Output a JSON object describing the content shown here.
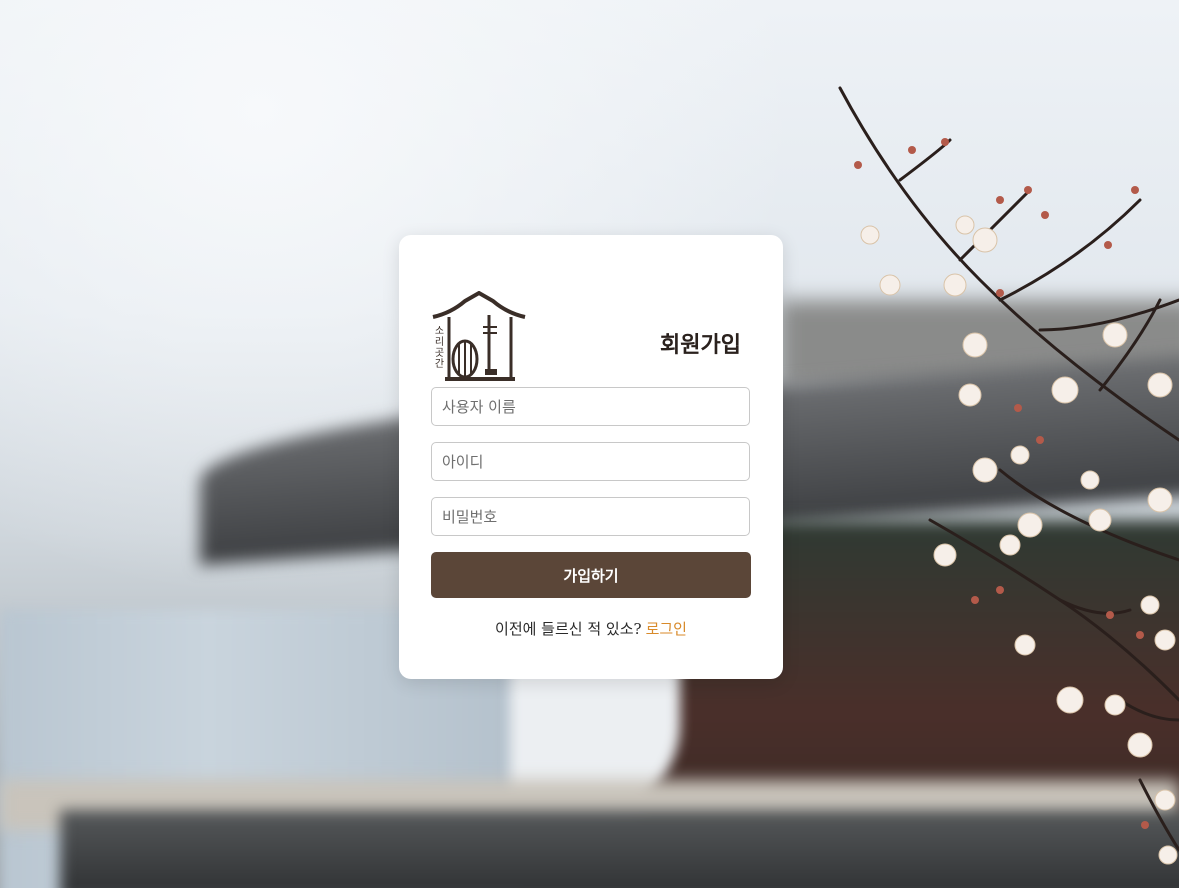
{
  "page": {
    "title": "회원가입"
  },
  "logo": {
    "text": "소리곳간"
  },
  "form": {
    "username_placeholder": "사용자 이름",
    "userid_placeholder": "아이디",
    "password_placeholder": "비밀번호",
    "submit_label": "가입하기"
  },
  "footer": {
    "prompt": "이전에 들르신 적 있소?",
    "login_link": "로그인"
  },
  "colors": {
    "button_bg": "#5b4638",
    "link": "#d88a2a",
    "card_bg": "#ffffff"
  }
}
